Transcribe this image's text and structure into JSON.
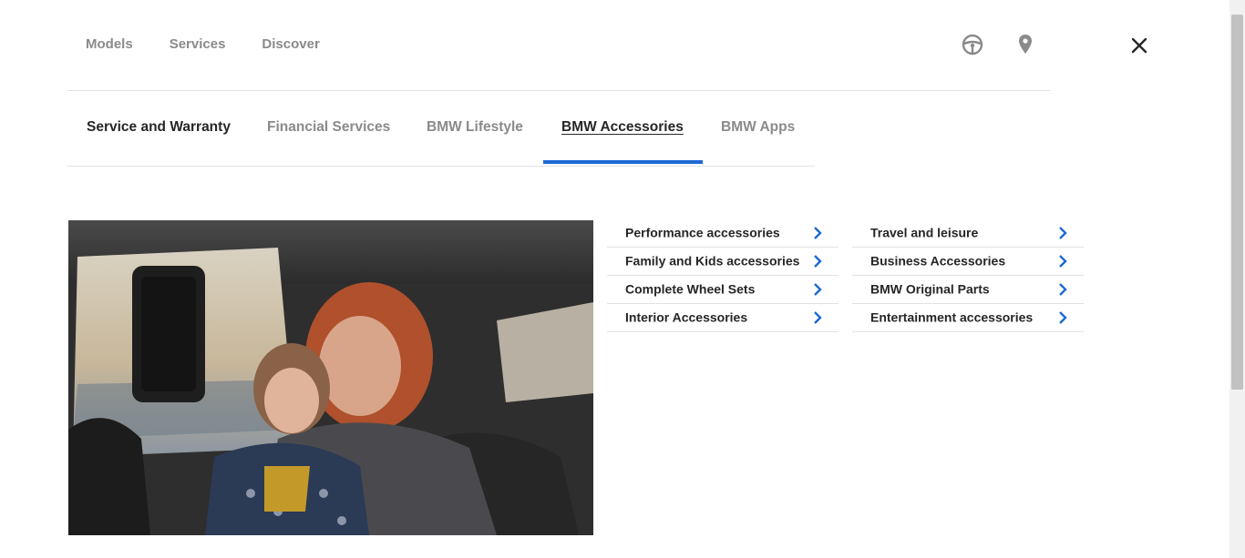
{
  "top_nav": {
    "items": [
      {
        "label": "Models"
      },
      {
        "label": "Services"
      },
      {
        "label": "Discover"
      }
    ],
    "icons": [
      "steering-wheel-icon",
      "location-pin-icon",
      "close-icon"
    ]
  },
  "tabs": [
    {
      "label": "Service and Warranty"
    },
    {
      "label": "Financial Services"
    },
    {
      "label": "BMW Lifestyle"
    },
    {
      "label": "BMW Accessories",
      "active": true
    },
    {
      "label": "BMW Apps"
    }
  ],
  "accent_color": "#1c69d4",
  "menu": {
    "left": [
      {
        "label": "Performance accessories"
      },
      {
        "label": "Family and Kids accessories"
      },
      {
        "label": "Complete Wheel Sets"
      },
      {
        "label": "Interior Accessories"
      }
    ],
    "right": [
      {
        "label": "Travel and leisure"
      },
      {
        "label": "Business Accessories"
      },
      {
        "label": "BMW Original Parts"
      },
      {
        "label": "Entertainment accessories"
      }
    ]
  }
}
